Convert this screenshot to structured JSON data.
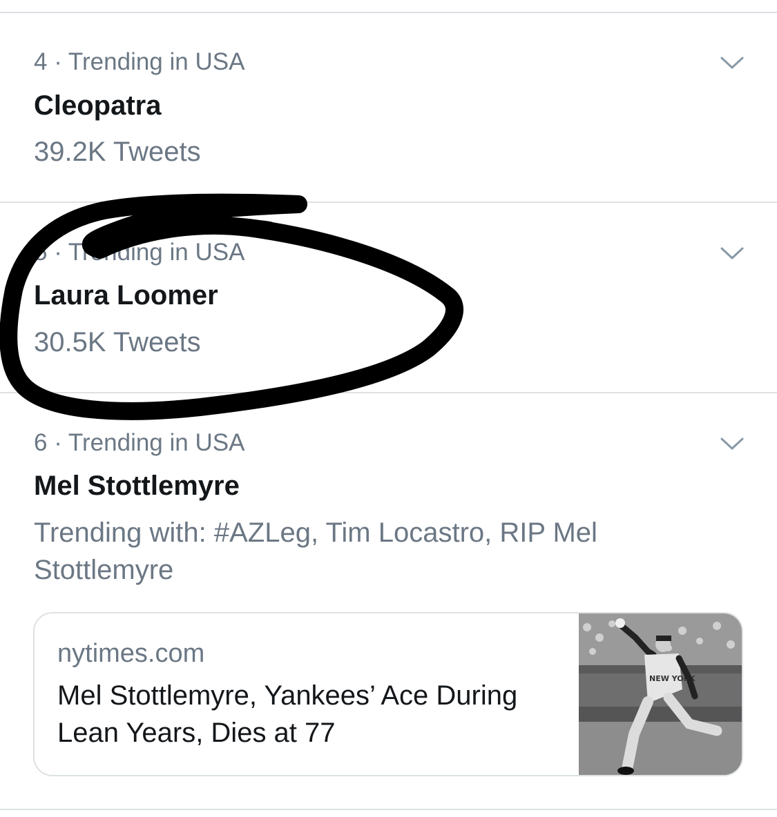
{
  "trends": [
    {
      "rank_label": "4 · Trending in USA",
      "name": "Cleopatra",
      "count": "39.2K Tweets"
    },
    {
      "rank_label": "5 · Trending in USA",
      "name": "Laura Loomer",
      "count": "30.5K Tweets"
    },
    {
      "rank_label": "6 · Trending in USA",
      "name": "Mel Stottlemyre",
      "context": "Trending with: #AZLeg, Tim Locastro, RIP Mel Stottlemyre",
      "card": {
        "domain": "nytimes.com",
        "headline": "Mel Stottlemyre, Yankees’ Ace During Lean Years, Dies at 77",
        "jersey_text": "NEW YORK"
      }
    }
  ],
  "icons": {
    "more_options": "chevron-down-icon"
  },
  "colors": {
    "primary_text": "#14171a",
    "secondary_text": "#6b7784",
    "divider": "#dde1e4",
    "annotation_ink": "#000000"
  }
}
